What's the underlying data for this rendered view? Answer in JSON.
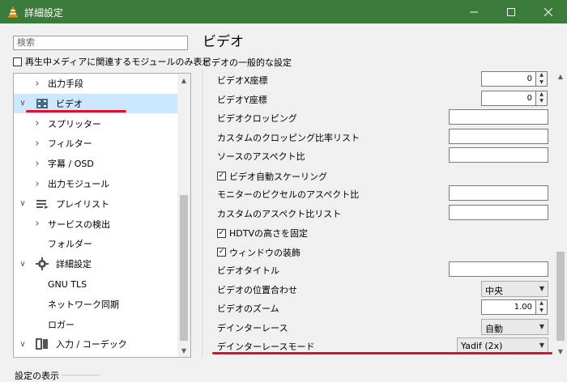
{
  "window": {
    "title": "詳細設定"
  },
  "sidebar": {
    "search_placeholder": "検索",
    "only_current_label": "再生中メディアに関連するモジュールのみ表示",
    "tree": [
      {
        "label": "出力手段",
        "level": 2,
        "selected": false,
        "icon": ""
      },
      {
        "label": "ビデオ",
        "level": 1,
        "selected": true,
        "icon": "video-icon"
      },
      {
        "label": "スプリッター",
        "level": 2,
        "selected": false,
        "icon": ""
      },
      {
        "label": "フィルター",
        "level": 2,
        "selected": false,
        "icon": ""
      },
      {
        "label": "字幕 / OSD",
        "level": 2,
        "selected": false,
        "icon": ""
      },
      {
        "label": "出力モジュール",
        "level": 2,
        "selected": false,
        "icon": ""
      },
      {
        "label": "プレイリスト",
        "level": 1,
        "selected": false,
        "icon": "playlist-icon"
      },
      {
        "label": "サービスの検出",
        "level": 2,
        "selected": false,
        "icon": ""
      },
      {
        "label": "フォルダー",
        "level": 2,
        "selected": false,
        "icon": ""
      },
      {
        "label": "詳細設定",
        "level": 1,
        "selected": false,
        "icon": "gear-icon"
      },
      {
        "label": "GNU TLS",
        "level": 2,
        "selected": false,
        "icon": ""
      },
      {
        "label": "ネットワーク同期",
        "level": 2,
        "selected": false,
        "icon": ""
      },
      {
        "label": "ロガー",
        "level": 2,
        "selected": false,
        "icon": ""
      },
      {
        "label": "入力 / コーデック",
        "level": 1,
        "selected": false,
        "icon": "codec-icon"
      }
    ]
  },
  "main": {
    "section_title": "ビデオ",
    "subtitle": "ビデオの一般的な設定",
    "rows": [
      {
        "label": "ビデオX座標",
        "control": "spin",
        "value": "0"
      },
      {
        "label": "ビデオY座標",
        "control": "spin",
        "value": "0"
      },
      {
        "label": "ビデオクロッピング",
        "control": "text",
        "value": ""
      },
      {
        "label": "カスタムのクロッピング比率リスト",
        "control": "text",
        "value": ""
      },
      {
        "label": "ソースのアスペクト比",
        "control": "text",
        "value": ""
      },
      {
        "label": "ビデオ自動スケーリング",
        "control": "check",
        "checked": true
      },
      {
        "label": "モニターのピクセルのアスペクト比",
        "control": "text",
        "value": ""
      },
      {
        "label": "カスタムのアスペクト比リスト",
        "control": "text",
        "value": ""
      },
      {
        "label": "HDTVの高さを固定",
        "control": "check",
        "checked": true
      },
      {
        "label": "ウィンドウの装飾",
        "control": "check",
        "checked": true
      },
      {
        "label": "ビデオタイトル",
        "control": "text",
        "value": ""
      },
      {
        "label": "ビデオの位置合わせ",
        "control": "combo",
        "value": "中央"
      },
      {
        "label": "ビデオのズーム",
        "control": "spin",
        "value": "1.00"
      },
      {
        "label": "デインターレース",
        "control": "combo",
        "value": "自動"
      },
      {
        "label": "デインターレースモード",
        "control": "combo-wide",
        "value": "Yadif (2x)"
      }
    ]
  },
  "footer": {
    "group_label": "設定の表示"
  },
  "colors": {
    "titlebar": "#3a7a3a",
    "selection": "#cce8ff",
    "highlight": "#e0102a"
  }
}
